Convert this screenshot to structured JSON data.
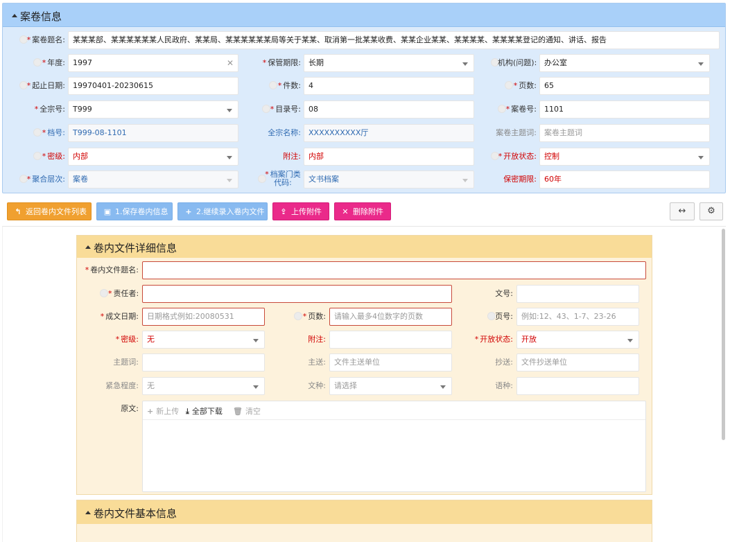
{
  "top": {
    "title": "案卷信息",
    "fields": {
      "file_title": {
        "label": "案卷题名:",
        "value": "某某某部、某某某某某某人民政府、某某局、某某某某某某局等关于某某、取消第一批某某收费、某某企业某某、某某某某、某某某某登记的通知、讲话、报告"
      },
      "year": {
        "label": "年度:",
        "value": "1997"
      },
      "retention": {
        "label": "保管期限:",
        "value": "长期"
      },
      "org": {
        "label": "机构(问题):",
        "value": "办公室"
      },
      "date_range": {
        "label": "起止日期:",
        "value": "19970401-20230615"
      },
      "count": {
        "label": "件数:",
        "value": "4"
      },
      "pages": {
        "label": "页数:",
        "value": "65"
      },
      "fonds": {
        "label": "全宗号:",
        "value": "T999"
      },
      "catalog": {
        "label": "目录号:",
        "value": "08"
      },
      "volume": {
        "label": "案卷号:",
        "value": "1101"
      },
      "archive_no": {
        "label": "档号:",
        "value": "T999-08-1101"
      },
      "fonds_name": {
        "label": "全宗名称:",
        "value": "XXXXXXXXXX厅"
      },
      "subject": {
        "label": "案卷主题词:",
        "placeholder": "案卷主题词"
      },
      "secret": {
        "label": "密级:",
        "value": "内部"
      },
      "note": {
        "label": "附注:",
        "value": "内部"
      },
      "open_status": {
        "label": "开放状态:",
        "value": "控制"
      },
      "level": {
        "label": "聚合层次:",
        "value": "案卷"
      },
      "category_line1": {
        "label": "档案门类",
        "label2": "代码:",
        "value": "文书档案"
      },
      "secret_period": {
        "label": "保密期限:",
        "value": "60年"
      }
    }
  },
  "toolbar": {
    "back": "返回卷内文件列表",
    "save": "1.保存卷内信息",
    "continue": "2.继续录入卷内文件",
    "upload": "上传附件",
    "delete": "删除附件"
  },
  "detail": {
    "title": "卷内文件详细信息",
    "doc_title": {
      "label": "卷内文件题名:",
      "value": ""
    },
    "responsible": {
      "label": "责任者:",
      "value": ""
    },
    "doc_no": {
      "label": "文号:",
      "value": ""
    },
    "date": {
      "label": "成文日期:",
      "placeholder": "日期格式例如:20080531"
    },
    "pages": {
      "label": "页数:",
      "placeholder": "请输入最多4位数字的页数"
    },
    "page_no": {
      "label": "页号:",
      "placeholder": "例如:12、43、1-7、23-26"
    },
    "secret": {
      "label": "密级:",
      "value": "无"
    },
    "note": {
      "label": "附注:",
      "value": ""
    },
    "open_status": {
      "label": "开放状态:",
      "value": "开放"
    },
    "subject": {
      "label": "主题词:",
      "value": ""
    },
    "main_send": {
      "label": "主送:",
      "placeholder": "文件主送单位"
    },
    "cc": {
      "label": "抄送:",
      "placeholder": "文件抄送单位"
    },
    "urgency": {
      "label": "紧急程度:",
      "value": "无"
    },
    "doc_type": {
      "label": "文种:",
      "placeholder": "请选择"
    },
    "language": {
      "label": "语种:",
      "value": ""
    },
    "original": {
      "label": "原文:",
      "new_upload": "新上传",
      "download_all": "全部下载",
      "clear": "清空"
    }
  },
  "basic": {
    "title": "卷内文件基本信息"
  }
}
